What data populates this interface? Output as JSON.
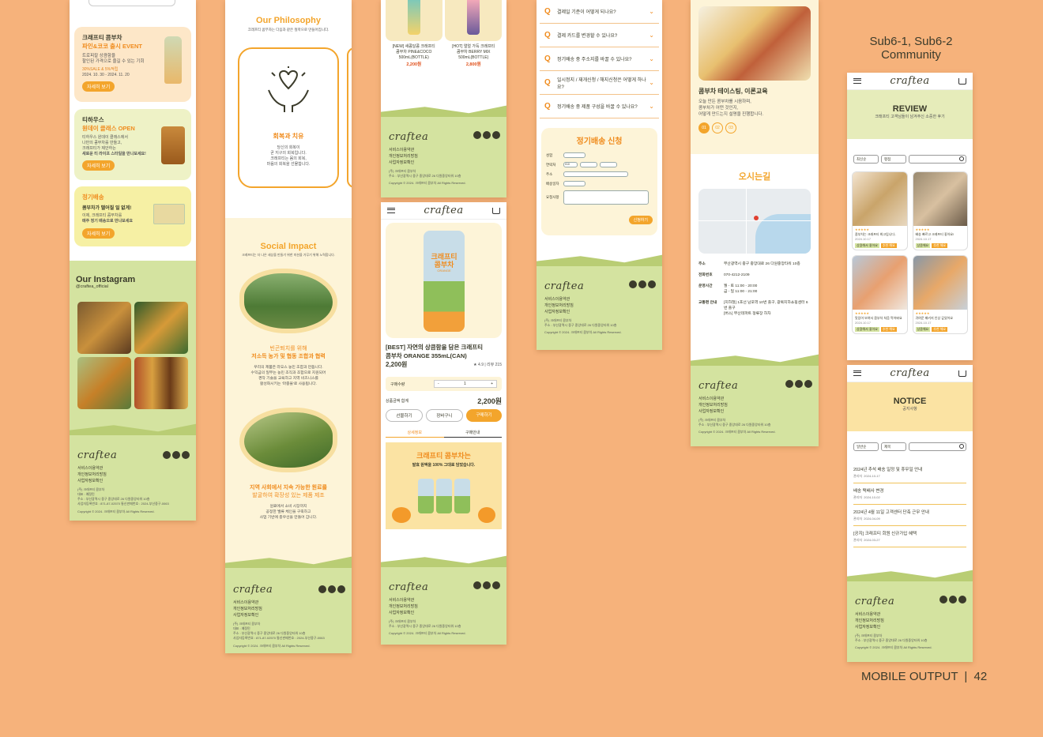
{
  "page_label": {
    "title": "Sub6-1, Sub6-2",
    "subtitle": "Community"
  },
  "page_number": {
    "text": "MOBILE OUTPUT",
    "num": "42"
  },
  "footer": {
    "logo": "craftea",
    "links": [
      "서비스이용약관",
      "개인정보처리방침",
      "사업자정보확인"
    ],
    "company": "(주) 크래프티 콤부차",
    "rep": "대표 : 예정민",
    "address": "주소 : 부산광역시 중구 중앙대로 26 다원중앙타워 10층",
    "biz": "사업자등록번호 : 871-87-02570   통신판매번호 : 2024-부산중구-0063",
    "copyright": "Copyright © 2024. 크래프티 콤부차 All Rights Reserved."
  },
  "screen1": {
    "events": [
      {
        "title_a": "크래프티 콤부차",
        "title_b": "파인&코코 출시 EVENT",
        "desc_a": "트로피칼 상큼함을",
        "desc_b": "할인된 가격으로 즐길 수 있는 기회",
        "meta_a": "30%SALE & 5%적립",
        "meta_b": "2024. 10. 30 - 2024. 11. 20",
        "btn": "자세히 보기"
      },
      {
        "title_a": "티하우스",
        "title_b": "원데이 클래스 OPEN",
        "desc_a": "티하우스 원데이 클래스에서",
        "desc_b": "나만의 콤부차를 만들고,",
        "meta_a": "크래프티가 제안하는",
        "meta_b": "새로운 티 라이프 스타일을 만나보세요!",
        "btn": "자세히 보기"
      },
      {
        "title_a": "정기배송",
        "title_b": "콤부차가 떨어질 일 없게!",
        "desc_a": "이제, 크래프티 콤부차를",
        "desc_b": "매주 정기 배송으로 만나보세요",
        "meta_a": "",
        "meta_b": "",
        "btn": "자세히 보기"
      }
    ],
    "instagram": {
      "title": "Our Instagram",
      "handle": "@craftea_official"
    }
  },
  "screen2": {
    "philosophy": {
      "title": "Our Philosophy",
      "sub": "크래프티 콤부차는 다음과 같은 철학으로 만들어집니다.",
      "card_title": "회복과 치유",
      "card_l1": "당신의 회복이",
      "card_l2": "곧 지구의 회복입니다.",
      "card_l3": "크래프티는 몸의 회복,",
      "card_l4": "마음의 회복을 선물합니다."
    },
    "impact": {
      "title": "Social Impact",
      "sub": "크래프티는 더 나은 세상을 만들기 위한 미션을 가무기 위해 노력합니다.",
      "h1a": "빈곤퇴치를 위해",
      "h1b": "저소득 농가 및 협동 조합과 협력",
      "p1a": "우리의 제품은 라오스 농민 조합과 만듭니다.",
      "p1b": "수익금의 일부는 농민 조직과 조합으로 지원되어",
      "p1c": "경작 기술을 교육하고 지역 비즈니스를",
      "p1d": "활성화시키는 '마중물'로 사용됩니다.",
      "h2a": "지역 사회에서 지속 가능한 원료를",
      "h2b": "발굴하여 확장성 있는 제품 제조",
      "p2a": "원료에서 소비 시장까지",
      "p2b": "공정한 밸류 체인을 구축하고",
      "p2c": "사업 기반에 충우선을 만들어 갑니다."
    }
  },
  "screen3": {
    "products": [
      {
        "name_a": "[NEW] 새콤달콤 크래프티",
        "name_b": "콤부차 PINE&COCO",
        "name_c": "500mL(BOTTLE)",
        "price": "2,200원"
      },
      {
        "name_a": "[HOT] 얼얼 가득 크래프티",
        "name_b": "콤부차 BERRY MIX",
        "name_c": "500mL(BOTTLE)",
        "price": "2,800원"
      }
    ]
  },
  "screen4": {
    "logo": "craftea",
    "product_title_a": "[BEST] 자연의 상큼함을 담은 크래프티",
    "product_title_b": "콤부차 ORANGE 355mL(CAN)",
    "price": "2,200원",
    "rating": "★ 4.9 | 리뷰 215",
    "qty_label": "구매수량",
    "qty": "1",
    "total_label": "상품금액 합계",
    "total": "2,200원",
    "btn_gift": "선물하기",
    "btn_cart": "장바구니",
    "btn_buy": "구매하기",
    "tab_detail": "상세정보",
    "tab_guide": "구매안내",
    "banner_title": "크래프티 콤부차는",
    "banner_sub": "발효 원액을 100% 그대로 담았습니다.",
    "can_text": "크래프티 콤부차",
    "can_flavor": "ORANGE"
  },
  "screen5": {
    "faq": [
      "결제일 기준이 어떻게 되나요?",
      "결제 카드를 변경할 수 있나요?",
      "정기배송 중 주소지를 바꿀 수 있나요?",
      "일시정지 / 재개신청 / 해지신청은 어떻게 하나요?",
      "정기배송 중 제품 구성을 바꿀 수 있나요?"
    ],
    "form_title": "정기배송 신청",
    "fields": [
      "성함",
      "연락처",
      "주소",
      "배송일자",
      "요청사항"
    ],
    "phone_prefix": "010",
    "submit": "신청하기"
  },
  "screen6": {
    "class_title": "콤부차 테이스팅, 이론교육",
    "class_l1": "오늘 만든 콤부차를 시음하며,",
    "class_l2": "콤부차가 어떤 것인지,",
    "class_l3": "어떻게 만드는지 설명을 진행합니다.",
    "steps": [
      "01",
      "02",
      "03"
    ],
    "map_title": "오시는길",
    "info": [
      {
        "k": "주소",
        "v": "부산광역시 중구 중앙대로 26 다원중앙타워 10층"
      },
      {
        "k": "전화번호",
        "v": "070-4212-2109"
      },
      {
        "k": "운영시간",
        "v": "월 - 토 11:00 - 20:00"
      },
      {
        "k": "",
        "v": "금 - 일 11:00 - 21:00"
      },
      {
        "k": "교통편 안내",
        "v": "[지하철] 1호선 남포역 10번 출구, 광복지하쇼핑센터 6번 출구"
      },
      {
        "k": "",
        "v": "[버스] 부산데파트 정류장 하차"
      }
    ]
  },
  "screen7": {
    "title": "REVIEW",
    "sub": "크래프티 고객님들이 남겨주신 소중한 후기",
    "sort": "최신순",
    "filter": "평점",
    "items": [
      {
        "stars": "★★★★★",
        "text": "콤부차는 크래프티 최고입니다..",
        "date": "2024.10.17",
        "tags": [
          "상큼해서 좋아요",
          "추천 해요"
        ]
      },
      {
        "stars": "★★★★★",
        "text": "배송 빠르고 크래프티 좋아요!",
        "date": "2024.10.17",
        "tags": [
          "상큼해요",
          "추천 해요"
        ]
      },
      {
        "stars": "★★★★★",
        "text": "맛있어 보여서 콤부차 처음 먹어봐요",
        "date": "2024.10.17",
        "tags": [
          "상큼해서 좋아요",
          "추천 해요"
        ]
      },
      {
        "stars": "★★★★★",
        "text": "귀여운 패키지 인상 깊었어요",
        "date": "2024.10.17",
        "tags": [
          "상큼해요",
          "추천 해요"
        ]
      }
    ]
  },
  "screen8": {
    "title": "NOTICE",
    "sub": "공지사항",
    "sort": "일반순",
    "filter": "제목",
    "items": [
      {
        "title": "2024년 추석 배송 일정 및 휴무일 안내",
        "who": "관리자",
        "date": "2024-10-17"
      },
      {
        "title": "배송 택배사 변경",
        "who": "관리자",
        "date": "2024-10-02"
      },
      {
        "title": "2024년 4월 11일 고객센터 단축 근무 안내",
        "who": "관리자",
        "date": "2024-04-09"
      },
      {
        "title": "[공지] 크래프티 회원 신규가입 혜택",
        "who": "관리자",
        "date": "2024-03-27"
      }
    ]
  }
}
